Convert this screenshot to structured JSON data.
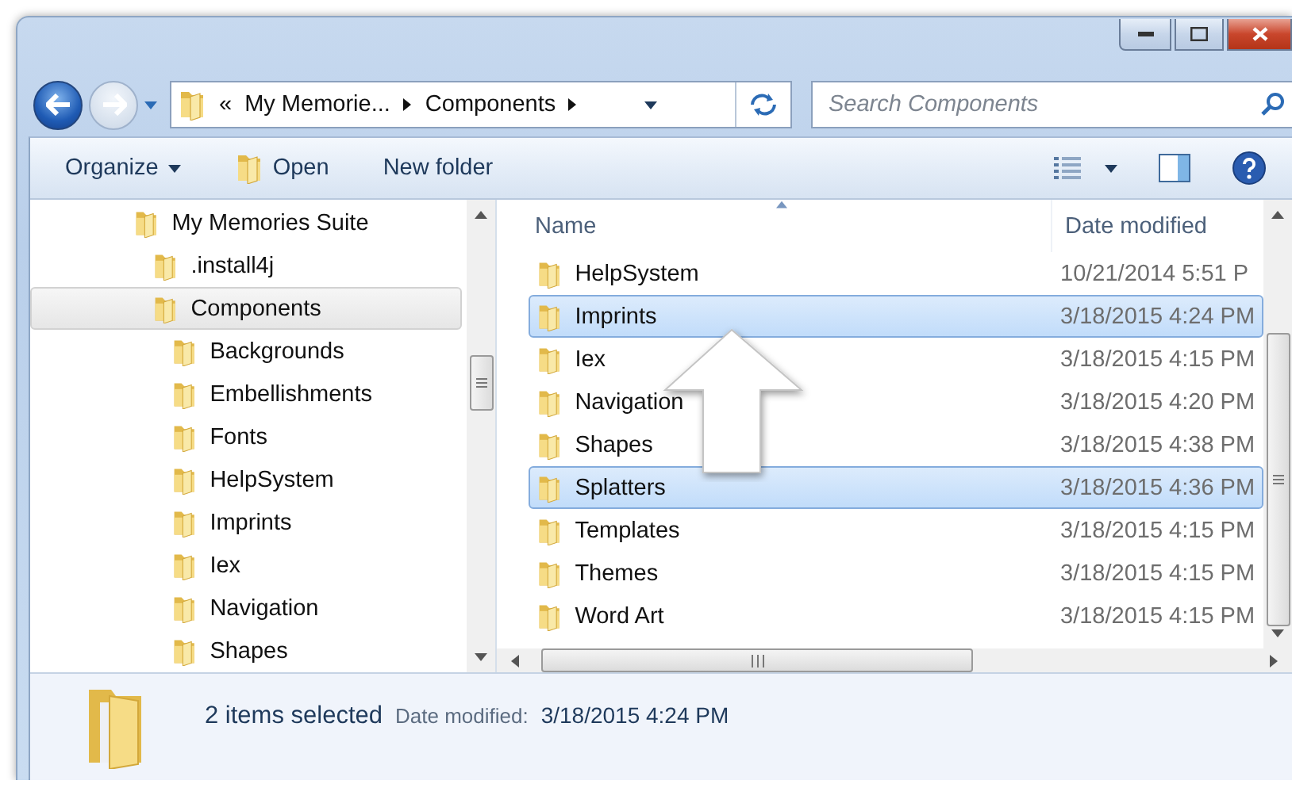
{
  "address_bar": {
    "overflow": "«",
    "crumbs": [
      "My Memorie...",
      "Components"
    ]
  },
  "search": {
    "placeholder": "Search Components"
  },
  "toolbar": {
    "buttons": [
      {
        "label": "Organize",
        "kind": "menu"
      },
      {
        "label": "Open",
        "kind": "icon"
      },
      {
        "label": "New folder",
        "kind": "plain"
      }
    ]
  },
  "nav_tree": [
    {
      "label": "My Memories Suite",
      "selected": false,
      "children": [
        {
          "label": ".install4j",
          "selected": false
        },
        {
          "label": "Components",
          "selected": true,
          "children": [
            {
              "label": "Backgrounds",
              "selected": false
            },
            {
              "label": "Embellishments",
              "selected": false
            },
            {
              "label": "Fonts",
              "selected": false
            },
            {
              "label": "HelpSystem",
              "selected": false
            },
            {
              "label": "Imprints",
              "selected": false
            },
            {
              "label": "Iex",
              "selected": false
            },
            {
              "label": "Navigation",
              "selected": false
            },
            {
              "label": "Shapes",
              "selected": false
            }
          ]
        }
      ]
    }
  ],
  "file_list": {
    "columns": [
      "Name",
      "Date modified"
    ],
    "rows": [
      {
        "name": "HelpSystem",
        "date": "10/21/2014 5:51 P",
        "selected": false
      },
      {
        "name": "Imprints",
        "date": "3/18/2015 4:24 PM",
        "selected": true
      },
      {
        "name": "Iex",
        "date": "3/18/2015 4:15 PM",
        "selected": false
      },
      {
        "name": "Navigation",
        "date": "3/18/2015 4:20 PM",
        "selected": false
      },
      {
        "name": "Shapes",
        "date": "3/18/2015 4:38 PM",
        "selected": false
      },
      {
        "name": "Splatters",
        "date": "3/18/2015 4:36 PM",
        "selected": true
      },
      {
        "name": "Templates",
        "date": "3/18/2015 4:15 PM",
        "selected": false
      },
      {
        "name": "Themes",
        "date": "3/18/2015 4:15 PM",
        "selected": false
      },
      {
        "name": "Word Art",
        "date": "3/18/2015 4:15 PM",
        "selected": false
      }
    ]
  },
  "status_bar": {
    "summary": "2 items selected",
    "date_label": "Date modified:",
    "date_value": "3/18/2015 4:24 PM"
  }
}
